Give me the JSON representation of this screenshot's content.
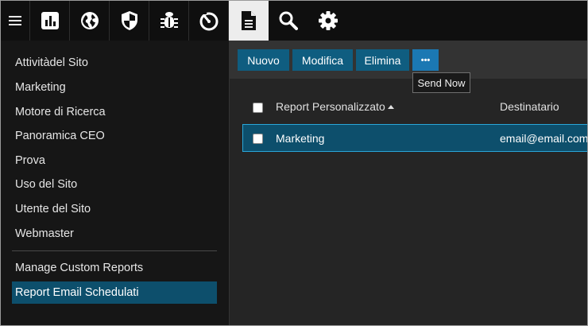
{
  "topbar": {
    "icons": [
      {
        "name": "hamburger-menu-icon"
      },
      {
        "name": "bar-chart-icon"
      },
      {
        "name": "globe-icon"
      },
      {
        "name": "shield-icon"
      },
      {
        "name": "bug-icon"
      },
      {
        "name": "speed-gauge-icon"
      },
      {
        "name": "document-icon",
        "active": true
      },
      {
        "name": "search-icon"
      },
      {
        "name": "gear-icon"
      }
    ]
  },
  "sidebar": {
    "reports": [
      "Attivitàdel Sito",
      "Marketing",
      "Motore di Ricerca",
      "Panoramica CEO",
      "Prova",
      "Uso del Sito",
      "Utente del Sito",
      "Webmaster"
    ],
    "manage": "Manage Custom Reports",
    "selected": "Report Email Schedulati"
  },
  "toolbar": {
    "new_label": "Nuovo",
    "edit_label": "Modifica",
    "delete_label": "Elimina",
    "more_label": "•••",
    "tooltip": "Send Now"
  },
  "table": {
    "headers": [
      "Report Personalizzato",
      "Destinatario"
    ],
    "sort_column": "Report Personalizzato",
    "rows": [
      {
        "report": "Marketing",
        "recipient": "email@email.com",
        "selected": true
      }
    ]
  },
  "colors": {
    "accent": "#0f5d80",
    "selection": "#0d4f6c",
    "more_button": "#1b78b3"
  }
}
